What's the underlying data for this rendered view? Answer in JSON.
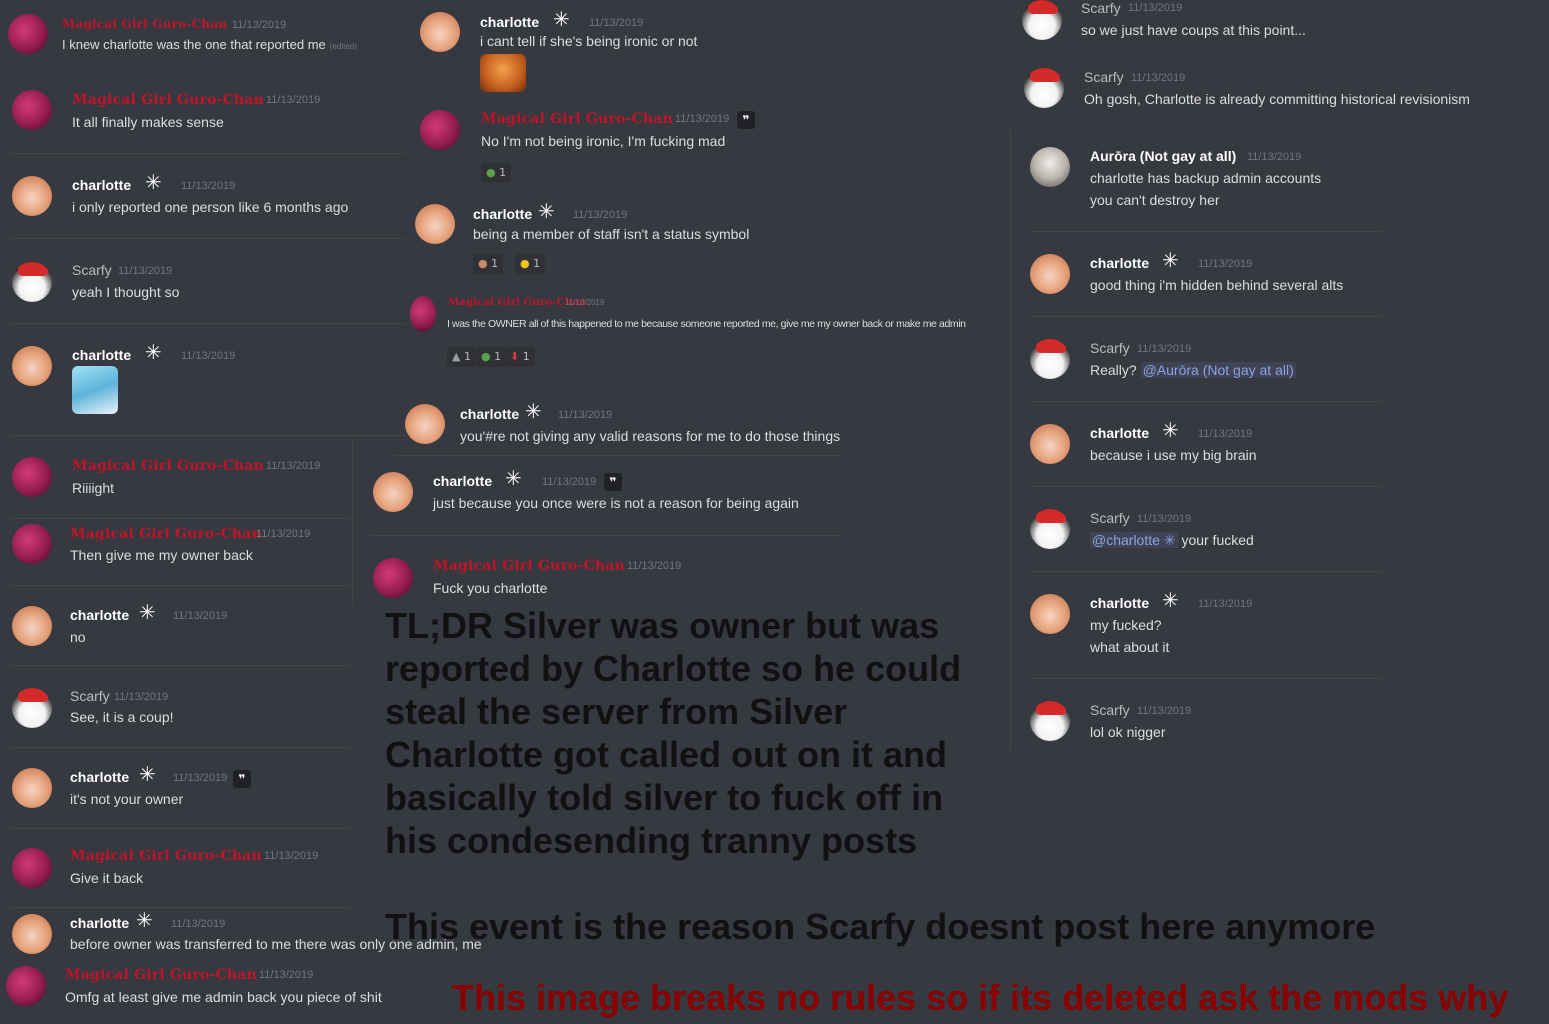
{
  "timestamp": "11/13/2019",
  "badge_glyph": "✳",
  "quote_glyph": "❞",
  "names": {
    "magical": "Magical Girl Guro-Chan",
    "charlotte": "charlotte",
    "scarfy": "Scarfy",
    "aurora": "Aurōra (Not gay at all)"
  },
  "col1": {
    "m1": "I knew charlotte was the one that reported me",
    "m1_edited": "(edited)",
    "m2": "It all finally makes sense",
    "m3": "i only reported one person like 6 months ago",
    "m4": "yeah I thought so",
    "m6": "Riiiight",
    "m7": "Then give me my owner back",
    "m8": "no",
    "m9": "See, it is a coup!",
    "m10": "it's not your owner",
    "m11": "Give it back",
    "m12": "before owner was transferred to me there was only one admin, me",
    "m13": "Omfg at least give me admin back you piece of shit"
  },
  "col2": {
    "m1": "i cant tell if she's being ironic or not",
    "m2": "No I'm not being ironic, I'm fucking mad",
    "m2_react": "1",
    "m3": "being a member of staff isn't a status symbol",
    "m3_react1": "1",
    "m3_react2": "1",
    "m4": "I was the OWNER all of this happened to me because someone reported me, give me my owner back or make me admin",
    "m4_react1": "1",
    "m4_react2": "1",
    "m4_react3": "1",
    "m5": "you'#re not giving any valid reasons for me to do those things",
    "m6": "just because you once were is not a reason for being again",
    "m7": "Fuck you charlotte"
  },
  "col3": {
    "m1": "so we just have coups at this point...",
    "m2": "Oh gosh, Charlotte is already committing historical revisionism",
    "m3a": "charlotte has backup admin accounts",
    "m3b": "you can't destroy her",
    "m4": "good thing i'm hidden behind several alts",
    "m5": "Really?",
    "m5_mention": "@Aurōra (Not gay at all)",
    "m6": "because i use my big brain",
    "m7_mention": "@charlotte",
    "m7": "your fucked",
    "m8a": "my fucked?",
    "m8b": "what about it",
    "m9": "lol ok nigger"
  },
  "caption": {
    "l1": "TL;DR Silver was owner but was",
    "l2": "reported by Charlotte so he could",
    "l3": "steal the server from Silver",
    "l4": "Charlotte got called out on it and",
    "l5": "basically told silver to fuck off in",
    "l6": "his condesending tranny posts",
    "line2": "This event is the reason Scarfy doesnt post here anymore",
    "line3": "This image breaks no rules so if its deleted ask the mods why"
  },
  "colors": {
    "background": "#36393f",
    "magical_name": "#c0142a",
    "caption_red": "#8b0000",
    "mention": "#8ea1e1"
  }
}
